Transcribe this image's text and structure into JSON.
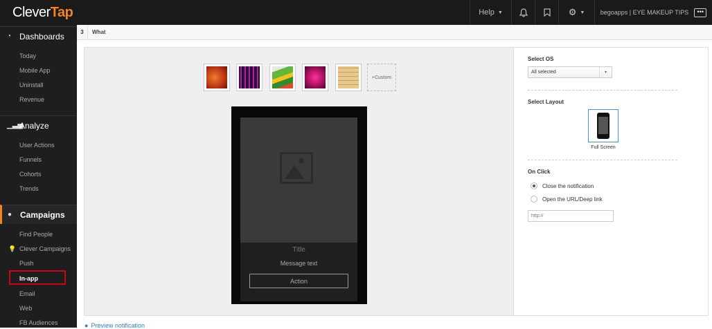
{
  "app": {
    "logo_clever": "Clever",
    "logo_tap": "Tap"
  },
  "topnav": {
    "help_label": "Help",
    "account_label": "begoapps | EYE MAKEUP TIPS",
    "more_label": "•••"
  },
  "sidebar": {
    "dashboards": {
      "label": "Dashboards",
      "items": [
        "Today",
        "Mobile App",
        "Uninstall",
        "Revenue"
      ]
    },
    "analyze": {
      "label": "Analyze",
      "items": [
        "User Actions",
        "Funnels",
        "Cohorts",
        "Trends"
      ]
    },
    "campaigns": {
      "label": "Campaigns",
      "items": [
        "Find People",
        "Clever Campaigns",
        "Push",
        "In-app",
        "Email",
        "Web",
        "FB Audiences"
      ]
    }
  },
  "breadcrumb": {
    "step": "3",
    "label": "What"
  },
  "editor": {
    "custom_label": "+Custom",
    "phone": {
      "title": "Title",
      "message": "Message text",
      "action": "Action"
    }
  },
  "settings": {
    "os": {
      "label": "Select OS",
      "value": "All selected"
    },
    "layout": {
      "label": "Select Layout",
      "option": "Full Screen"
    },
    "onclick": {
      "label": "On Click",
      "options": [
        "Close the notification",
        "Open the URL/Deep link"
      ],
      "url_placeholder": "http://"
    }
  },
  "footer": {
    "preview_label": "Preview notification"
  },
  "colors": {
    "brand_accent": "#f5821f",
    "highlight": "#d0021b",
    "link": "#2f7fc1"
  }
}
